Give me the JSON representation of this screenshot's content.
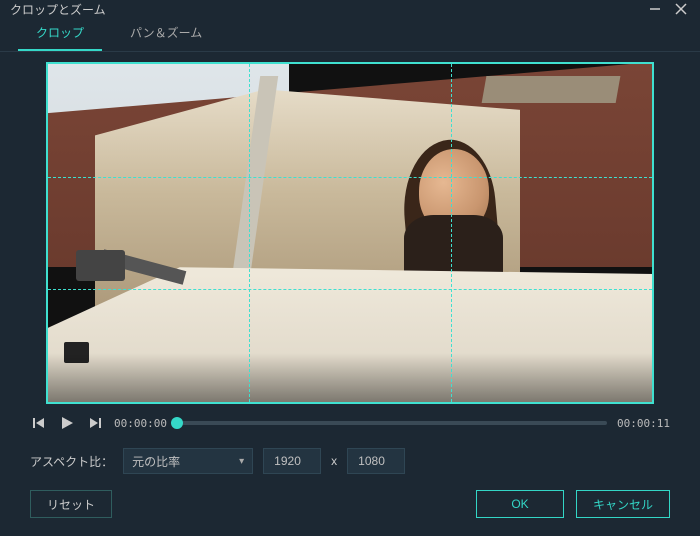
{
  "titlebar": {
    "title": "クロップとズーム"
  },
  "tabs": {
    "crop": "クロップ",
    "panzoom": "パン＆ズーム"
  },
  "playbar": {
    "time_current": "00:00:00",
    "time_total": "00:00:11"
  },
  "aspect": {
    "label": "アスペクト比：",
    "selected": "元の比率",
    "width": "1920",
    "sep": "x",
    "height": "1080"
  },
  "footer": {
    "reset": "リセット",
    "ok": "OK",
    "cancel": "キャンセル"
  },
  "icons": {
    "prev": "prev-frame-icon",
    "play": "play-icon",
    "next": "next-frame-icon",
    "min": "minimize-icon",
    "close": "close-icon",
    "chev": "chevron-down-icon"
  }
}
